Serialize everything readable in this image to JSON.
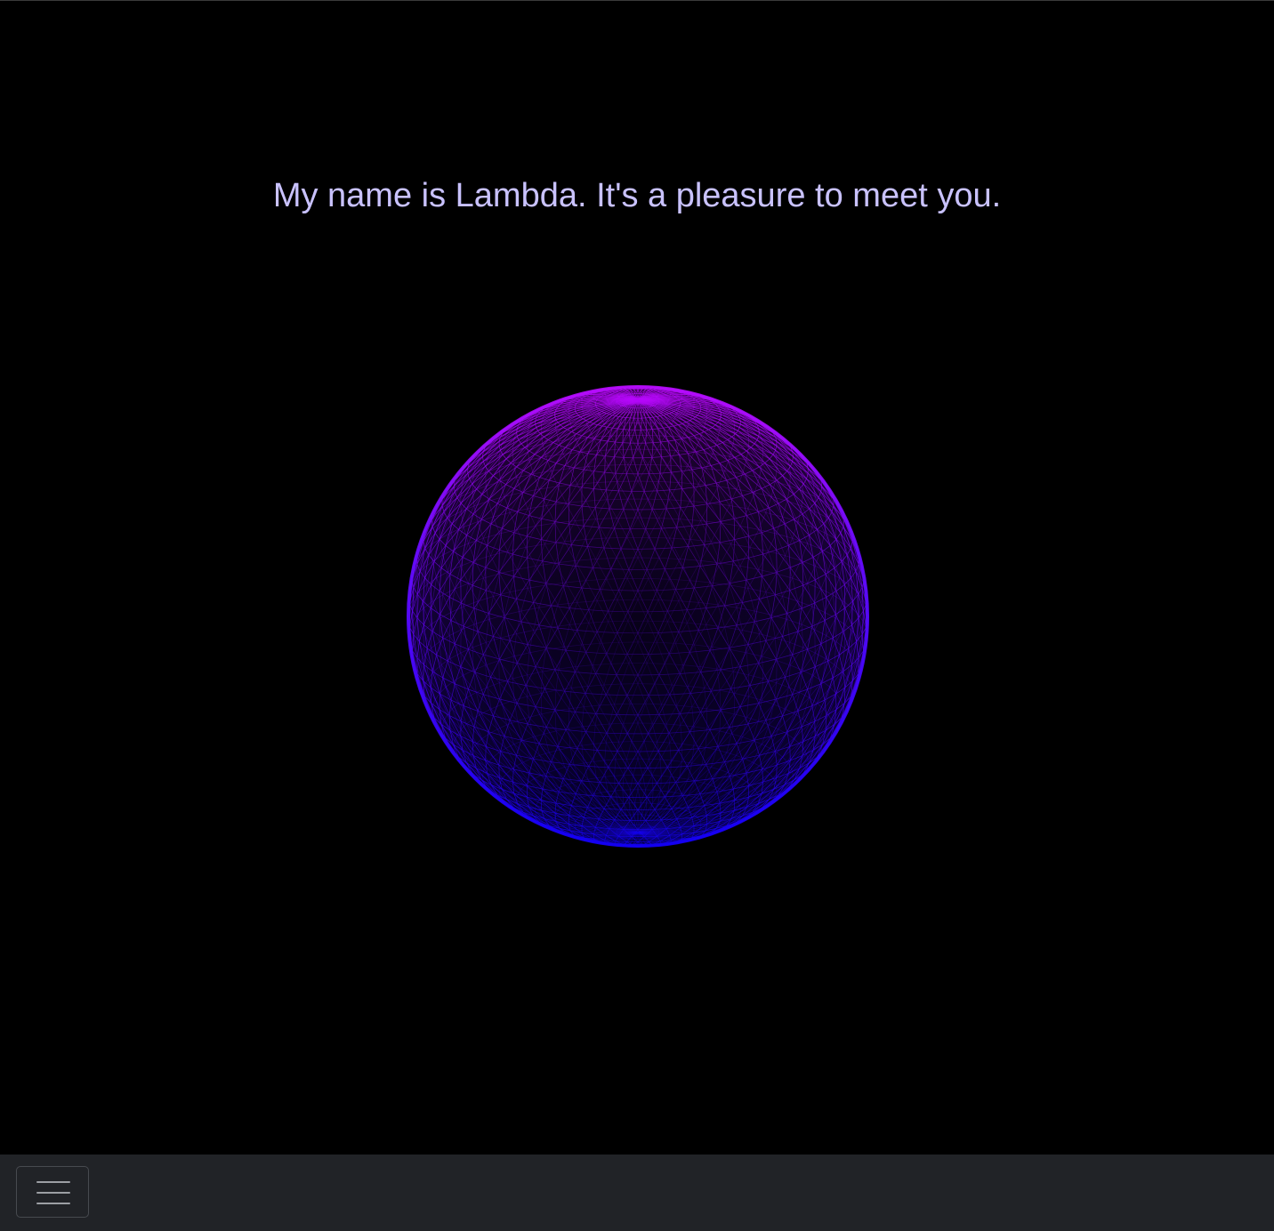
{
  "greeting": {
    "text": "My name is Lambda. It's a pleasure to meet you."
  },
  "orb": {
    "icon": "wireframe-sphere-icon",
    "colors": {
      "top": "#b40aff",
      "bottom": "#1a00ff",
      "background": "#000000"
    }
  },
  "navbar": {
    "toggle_icon": "hamburger-menu-icon",
    "background": "#212327"
  },
  "colors": {
    "text": "#c9c2ff"
  }
}
